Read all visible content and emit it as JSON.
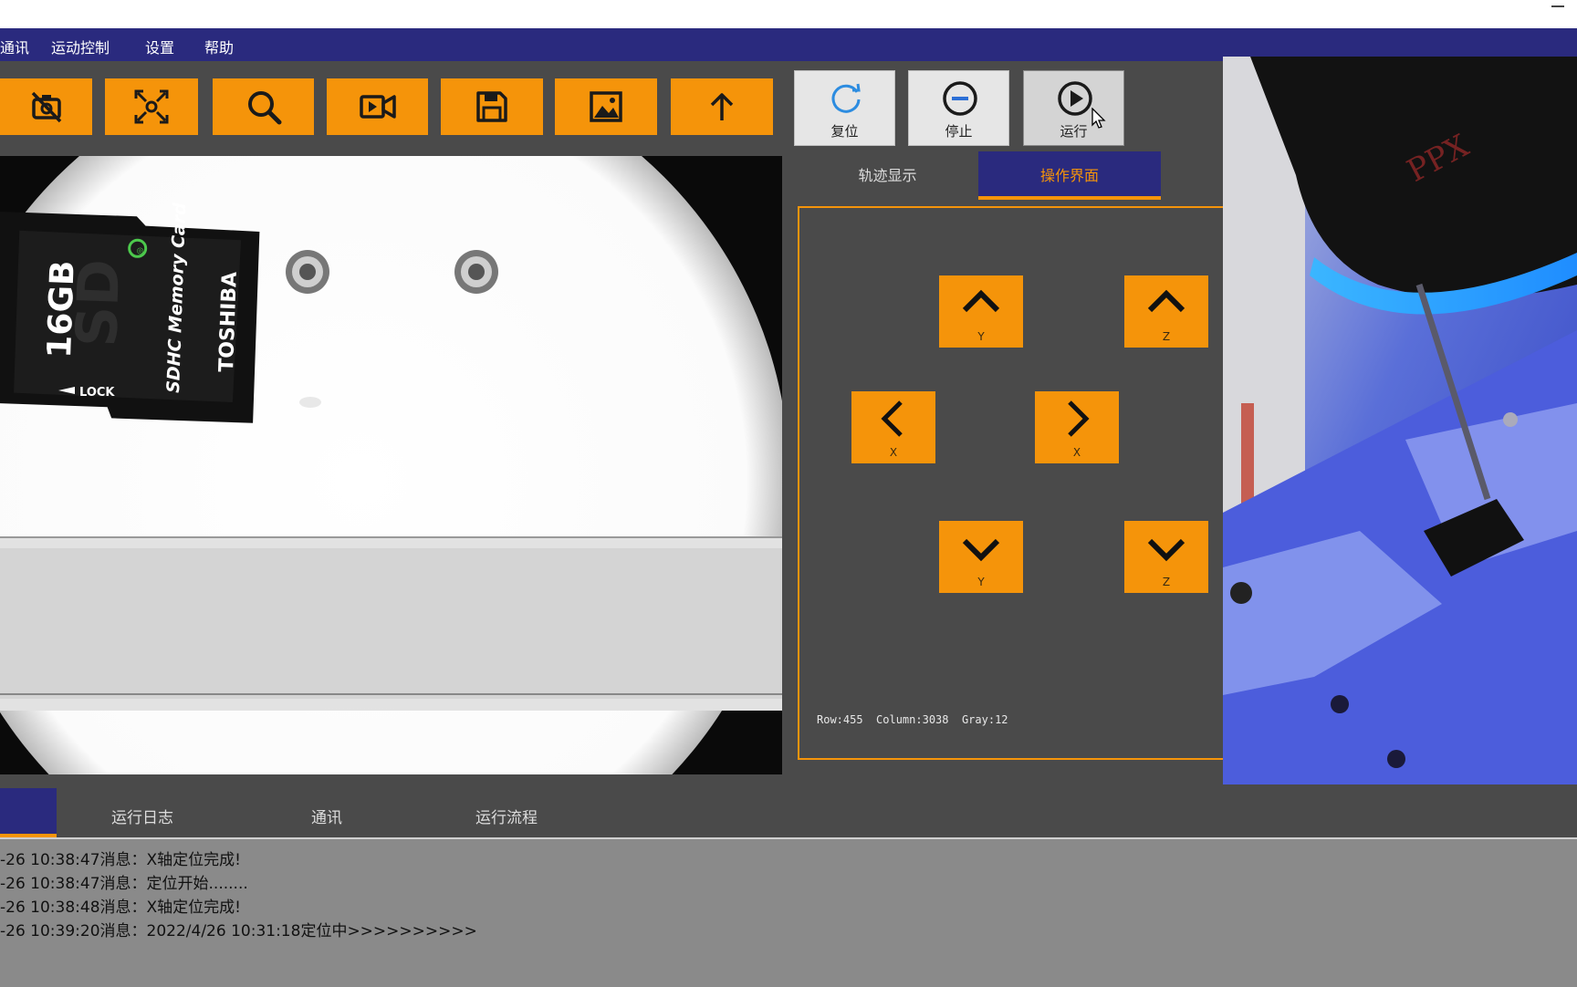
{
  "menu": {
    "items": [
      "通讯",
      "运动控制",
      "设置",
      "帮助"
    ]
  },
  "toolbar": {
    "icons": [
      "camera-off-icon",
      "fit-screen-icon",
      "zoom-icon",
      "video-icon",
      "save-icon",
      "image-icon",
      "upload-arrow-icon"
    ]
  },
  "controls": {
    "reset": "复位",
    "stop": "停止",
    "run": "运行"
  },
  "panel_tabs": {
    "trajectory": "轨迹显示",
    "operation": "操作界面"
  },
  "jog": {
    "y_up": "Y",
    "z_up": "Z",
    "x_left": "X",
    "x_right": "X",
    "y_down": "Y",
    "z_down": "Z"
  },
  "readout": "Row:455  Column:3038  Gray:12",
  "viewer": {
    "card_capacity": "16GB",
    "card_type": "SDHC Memory Card",
    "card_brand": "TOSHIBA",
    "card_lock": "LOCK"
  },
  "bottom_tabs": {
    "log": "运行日志",
    "comm": "通讯",
    "flow": "运行流程"
  },
  "log_lines": [
    "-26 10:38:47消息：X轴定位完成!",
    "-26 10:38:47消息：定位开始........",
    "-26 10:38:48消息：X轴定位完成!",
    "-26 10:39:20消息：2022/4/26 10:31:18定位中>>>>>>>>>>"
  ],
  "colors": {
    "accent": "#f5940a",
    "menu_bg": "#2a2a7e",
    "panel_bg": "#4a4a4a",
    "log_bg": "#8a8a8a"
  }
}
